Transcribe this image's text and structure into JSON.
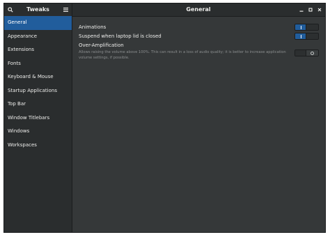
{
  "sidebar_header": {
    "title": "Tweaks",
    "search_icon": "search-icon",
    "menu_icon": "hamburger-menu-icon"
  },
  "main_header": {
    "title": "General",
    "minimize_icon": "minimize-icon",
    "maximize_icon": "maximize-icon",
    "close_icon": "close-icon"
  },
  "sidebar": {
    "items": [
      {
        "label": "General",
        "active": true
      },
      {
        "label": "Appearance",
        "active": false
      },
      {
        "label": "Extensions",
        "active": false
      },
      {
        "label": "Fonts",
        "active": false
      },
      {
        "label": "Keyboard & Mouse",
        "active": false
      },
      {
        "label": "Startup Applications",
        "active": false
      },
      {
        "label": "Top Bar",
        "active": false
      },
      {
        "label": "Window Titlebars",
        "active": false
      },
      {
        "label": "Windows",
        "active": false
      },
      {
        "label": "Workspaces",
        "active": false
      }
    ]
  },
  "settings": {
    "animations": {
      "label": "Animations",
      "enabled": true
    },
    "suspend_lid": {
      "label": "Suspend when laptop lid is closed",
      "enabled": true
    },
    "over_amplification": {
      "label": "Over-Amplification",
      "description": "Allows raising the volume above 100%. This can result in a loss of audio quality; it is better to increase application volume settings, if possible.",
      "enabled": false
    }
  },
  "colors": {
    "accent": "#215d9c",
    "window_bg": "#353839",
    "sidebar_bg": "#2a2d2e",
    "text": "#eeeeec",
    "dim_text": "#8b8e8f"
  }
}
